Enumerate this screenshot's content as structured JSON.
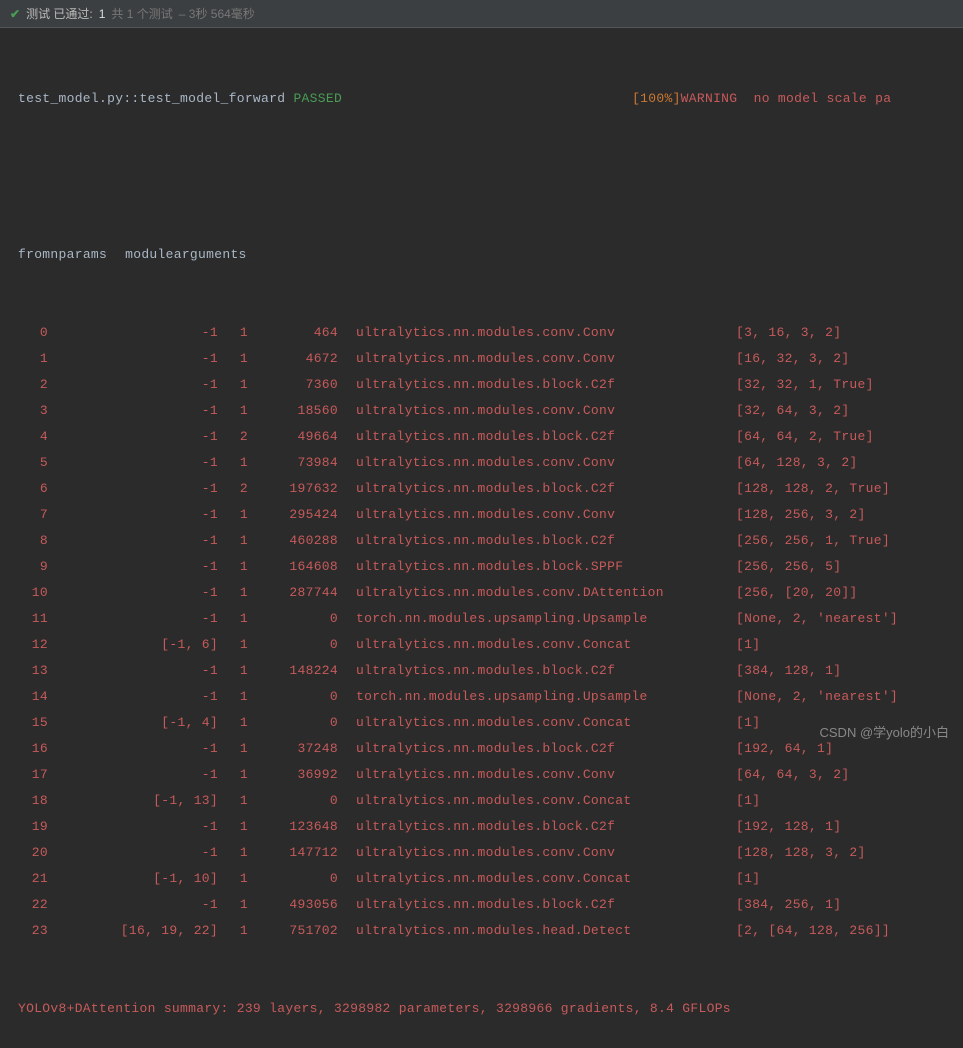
{
  "topbar": {
    "label": "测试 已通过:",
    "count": "1",
    "total": "共 1 个测试",
    "time": "– 3秒 564毫秒"
  },
  "result": {
    "name": "test_model.py::test_model_forward",
    "status": "PASSED",
    "pct": "[100%]",
    "warn_label": "WARNING",
    "warn_msg": "  no model scale pa"
  },
  "headers": {
    "idx": "",
    "from": "from",
    "n": "n",
    "params": "params",
    "module": "module",
    "args": "arguments"
  },
  "rows": [
    {
      "idx": "0",
      "from": "-1",
      "n": "1",
      "params": "464",
      "module": "ultralytics.nn.modules.conv.Conv",
      "args": "[3, 16, 3, 2]"
    },
    {
      "idx": "1",
      "from": "-1",
      "n": "1",
      "params": "4672",
      "module": "ultralytics.nn.modules.conv.Conv",
      "args": "[16, 32, 3, 2]"
    },
    {
      "idx": "2",
      "from": "-1",
      "n": "1",
      "params": "7360",
      "module": "ultralytics.nn.modules.block.C2f",
      "args": "[32, 32, 1, True]"
    },
    {
      "idx": "3",
      "from": "-1",
      "n": "1",
      "params": "18560",
      "module": "ultralytics.nn.modules.conv.Conv",
      "args": "[32, 64, 3, 2]"
    },
    {
      "idx": "4",
      "from": "-1",
      "n": "2",
      "params": "49664",
      "module": "ultralytics.nn.modules.block.C2f",
      "args": "[64, 64, 2, True]"
    },
    {
      "idx": "5",
      "from": "-1",
      "n": "1",
      "params": "73984",
      "module": "ultralytics.nn.modules.conv.Conv",
      "args": "[64, 128, 3, 2]"
    },
    {
      "idx": "6",
      "from": "-1",
      "n": "2",
      "params": "197632",
      "module": "ultralytics.nn.modules.block.C2f",
      "args": "[128, 128, 2, True]"
    },
    {
      "idx": "7",
      "from": "-1",
      "n": "1",
      "params": "295424",
      "module": "ultralytics.nn.modules.conv.Conv",
      "args": "[128, 256, 3, 2]"
    },
    {
      "idx": "8",
      "from": "-1",
      "n": "1",
      "params": "460288",
      "module": "ultralytics.nn.modules.block.C2f",
      "args": "[256, 256, 1, True]"
    },
    {
      "idx": "9",
      "from": "-1",
      "n": "1",
      "params": "164608",
      "module": "ultralytics.nn.modules.block.SPPF",
      "args": "[256, 256, 5]"
    },
    {
      "idx": "10",
      "from": "-1",
      "n": "1",
      "params": "287744",
      "module": "ultralytics.nn.modules.conv.DAttention",
      "args": "[256, [20, 20]]"
    },
    {
      "idx": "11",
      "from": "-1",
      "n": "1",
      "params": "0",
      "module": "torch.nn.modules.upsampling.Upsample",
      "args": "[None, 2, 'nearest']"
    },
    {
      "idx": "12",
      "from": "[-1, 6]",
      "n": "1",
      "params": "0",
      "module": "ultralytics.nn.modules.conv.Concat",
      "args": "[1]"
    },
    {
      "idx": "13",
      "from": "-1",
      "n": "1",
      "params": "148224",
      "module": "ultralytics.nn.modules.block.C2f",
      "args": "[384, 128, 1]"
    },
    {
      "idx": "14",
      "from": "-1",
      "n": "1",
      "params": "0",
      "module": "torch.nn.modules.upsampling.Upsample",
      "args": "[None, 2, 'nearest']"
    },
    {
      "idx": "15",
      "from": "[-1, 4]",
      "n": "1",
      "params": "0",
      "module": "ultralytics.nn.modules.conv.Concat",
      "args": "[1]"
    },
    {
      "idx": "16",
      "from": "-1",
      "n": "1",
      "params": "37248",
      "module": "ultralytics.nn.modules.block.C2f",
      "args": "[192, 64, 1]"
    },
    {
      "idx": "17",
      "from": "-1",
      "n": "1",
      "params": "36992",
      "module": "ultralytics.nn.modules.conv.Conv",
      "args": "[64, 64, 3, 2]"
    },
    {
      "idx": "18",
      "from": "[-1, 13]",
      "n": "1",
      "params": "0",
      "module": "ultralytics.nn.modules.conv.Concat",
      "args": "[1]"
    },
    {
      "idx": "19",
      "from": "-1",
      "n": "1",
      "params": "123648",
      "module": "ultralytics.nn.modules.block.C2f",
      "args": "[192, 128, 1]"
    },
    {
      "idx": "20",
      "from": "-1",
      "n": "1",
      "params": "147712",
      "module": "ultralytics.nn.modules.conv.Conv",
      "args": "[128, 128, 3, 2]"
    },
    {
      "idx": "21",
      "from": "[-1, 10]",
      "n": "1",
      "params": "0",
      "module": "ultralytics.nn.modules.conv.Concat",
      "args": "[1]"
    },
    {
      "idx": "22",
      "from": "-1",
      "n": "1",
      "params": "493056",
      "module": "ultralytics.nn.modules.block.C2f",
      "args": "[384, 256, 1]"
    },
    {
      "idx": "23",
      "from": "[16, 19, 22]",
      "n": "1",
      "params": "751702",
      "module": "ultralytics.nn.modules.head.Detect",
      "args": "[2, [64, 128, 256]]"
    }
  ],
  "summary": "YOLOv8+DAttention summary: 239 layers, 3298982 parameters, 3298966 gradients, 8.4 GFLOPs",
  "watermark": "CSDN @学yolo的小白"
}
